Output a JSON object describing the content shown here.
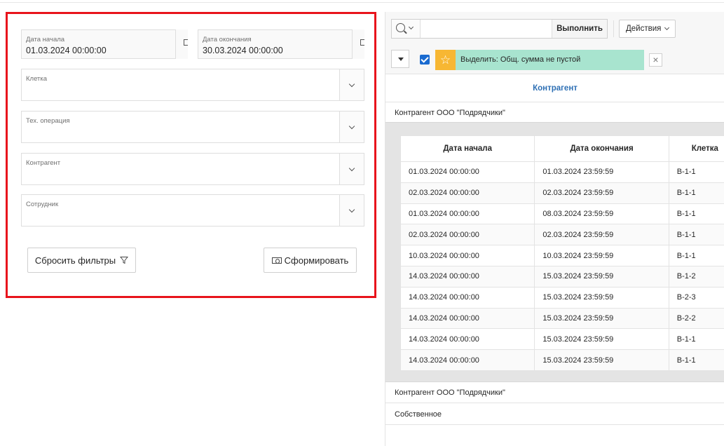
{
  "filters": {
    "date_start": {
      "label": "Дата начала",
      "value": "01.03.2024 00:00:00"
    },
    "date_end": {
      "label": "Дата окончания",
      "value": "30.03.2024 00:00:00"
    },
    "cell": {
      "label": "Клетка",
      "value": ""
    },
    "tech_operation": {
      "label": "Тех. операция",
      "value": ""
    },
    "counterparty": {
      "label": "Контрагент",
      "value": ""
    },
    "employee": {
      "label": "Сотрудник",
      "value": ""
    },
    "reset_label": "Сбросить фильтры",
    "generate_label": "Сформировать"
  },
  "toolbar": {
    "search_placeholder": "",
    "go_label": "Выполнить",
    "actions_label": "Действия",
    "highlight_text": "Выделить: Общ. сумма не пустой",
    "highlight_color": "#a8e4cf",
    "star_color": "#f7b733"
  },
  "report": {
    "group_header": "Контрагент",
    "group_rows": [
      "Контрагент ООО \"Подрядчики\"",
      "Контрагент ООО \"Подрядчики\"",
      "Собственное"
    ],
    "columns": [
      "Дата начала",
      "Дата окончания",
      "Клетка"
    ],
    "rows": [
      [
        "01.03.2024 00:00:00",
        "01.03.2024 23:59:59",
        "B-1-1"
      ],
      [
        "02.03.2024 00:00:00",
        "02.03.2024 23:59:59",
        "B-1-1"
      ],
      [
        "01.03.2024 00:00:00",
        "08.03.2024 23:59:59",
        "B-1-1"
      ],
      [
        "02.03.2024 00:00:00",
        "02.03.2024 23:59:59",
        "B-1-1"
      ],
      [
        "10.03.2024 00:00:00",
        "10.03.2024 23:59:59",
        "B-1-1"
      ],
      [
        "14.03.2024 00:00:00",
        "15.03.2024 23:59:59",
        "B-1-2"
      ],
      [
        "14.03.2024 00:00:00",
        "15.03.2024 23:59:59",
        "B-2-3"
      ],
      [
        "14.03.2024 00:00:00",
        "15.03.2024 23:59:59",
        "B-2-2"
      ],
      [
        "14.03.2024 00:00:00",
        "15.03.2024 23:59:59",
        "B-1-1"
      ],
      [
        "14.03.2024 00:00:00",
        "15.03.2024 23:59:59",
        "B-1-1"
      ]
    ]
  },
  "colors": {
    "accent": "#2d6fb4",
    "highlight_frame": "#e8141c",
    "checkbox": "#1a6bd0"
  }
}
